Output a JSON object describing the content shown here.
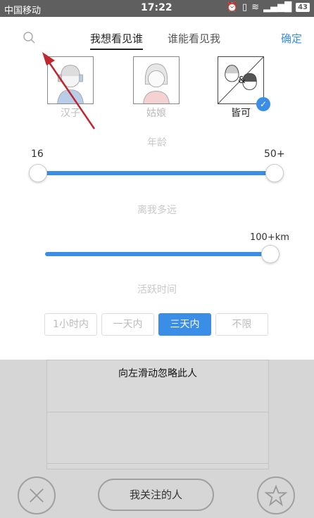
{
  "status_bar": {
    "carrier": "中国移动",
    "time": "17:22",
    "battery": "43"
  },
  "header": {
    "tab_active": "我想看见谁",
    "tab_inactive": "谁能看见我",
    "confirm": "确定"
  },
  "gender_options": [
    {
      "label": "汉子",
      "selected": false
    },
    {
      "label": "姑娘",
      "selected": false
    },
    {
      "label": "皆可",
      "selected": true
    }
  ],
  "age": {
    "title": "年龄",
    "min_label": "16",
    "max_label": "50+",
    "selected_min": "16",
    "selected_max": "50+"
  },
  "distance": {
    "title": "离我多远",
    "value_label": "100+km"
  },
  "active_time": {
    "title": "活跃时间",
    "options": [
      "1小时内",
      "一天内",
      "三天内",
      "不限"
    ],
    "selected": "三天内"
  },
  "background": {
    "swipe_hint": "向左滑动忽略此人",
    "follow_button": "我关注的人"
  },
  "colors": {
    "accent": "#3a8ee6",
    "annotation_arrow": "#c0262d"
  }
}
